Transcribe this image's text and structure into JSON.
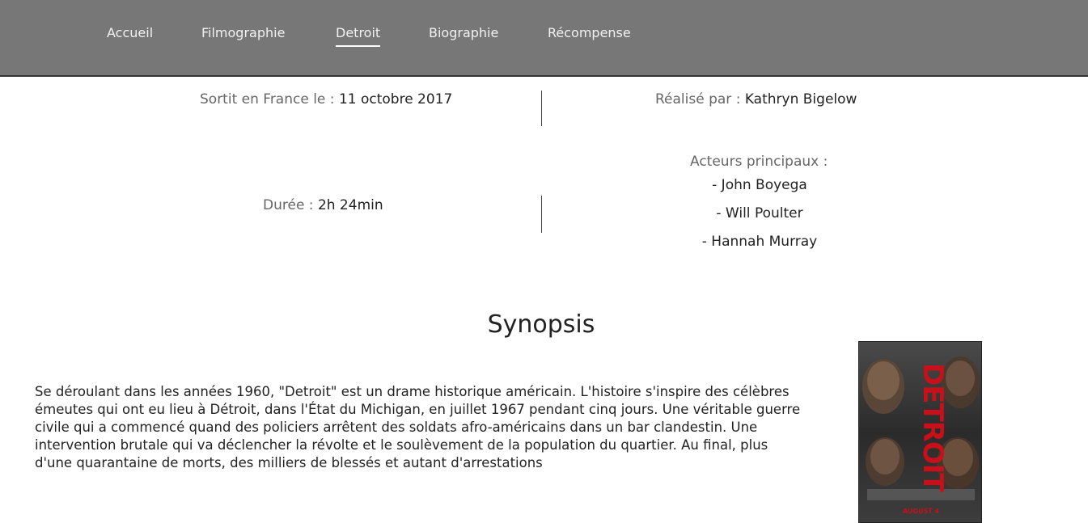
{
  "nav": {
    "items": [
      {
        "label": "Accueil",
        "active": false
      },
      {
        "label": "Filmographie",
        "active": false
      },
      {
        "label": "Detroit",
        "active": true
      },
      {
        "label": "Biographie",
        "active": false
      },
      {
        "label": "Récompense",
        "active": false
      }
    ]
  },
  "info": {
    "release_label": "Sortit en France le :",
    "release_value": "11 octobre 2017",
    "director_label": "Réalisé par :",
    "director_value": "Kathryn Bigelow",
    "duration_label": "Durée :",
    "duration_value": "2h 24min",
    "actors_label": "Acteurs principaux :",
    "actors": [
      "- John Boyega",
      "- Will Poulter",
      "- Hannah Murray"
    ]
  },
  "synopsis": {
    "title": "Synopsis",
    "text": "Se déroulant dans les années 1960, \"Detroit\" est un drame historique américain. L'histoire s'inspire des célèbres émeutes qui ont eu lieu à Détroit, dans l'État du Michigan, en juillet 1967 pendant cinq jours. Une véritable guerre civile qui a commencé quand des policiers arrêtent des soldats afro-américains dans un bar clandestin. Une intervention brutale qui va déclencher la révolte et le soulèvement de la population du quartier. Au final, plus d'une quarantaine de morts, des milliers de blessés et autant d'arrestations"
  },
  "poster": {
    "title": "DETROIT",
    "date": "AUGUST 4"
  }
}
